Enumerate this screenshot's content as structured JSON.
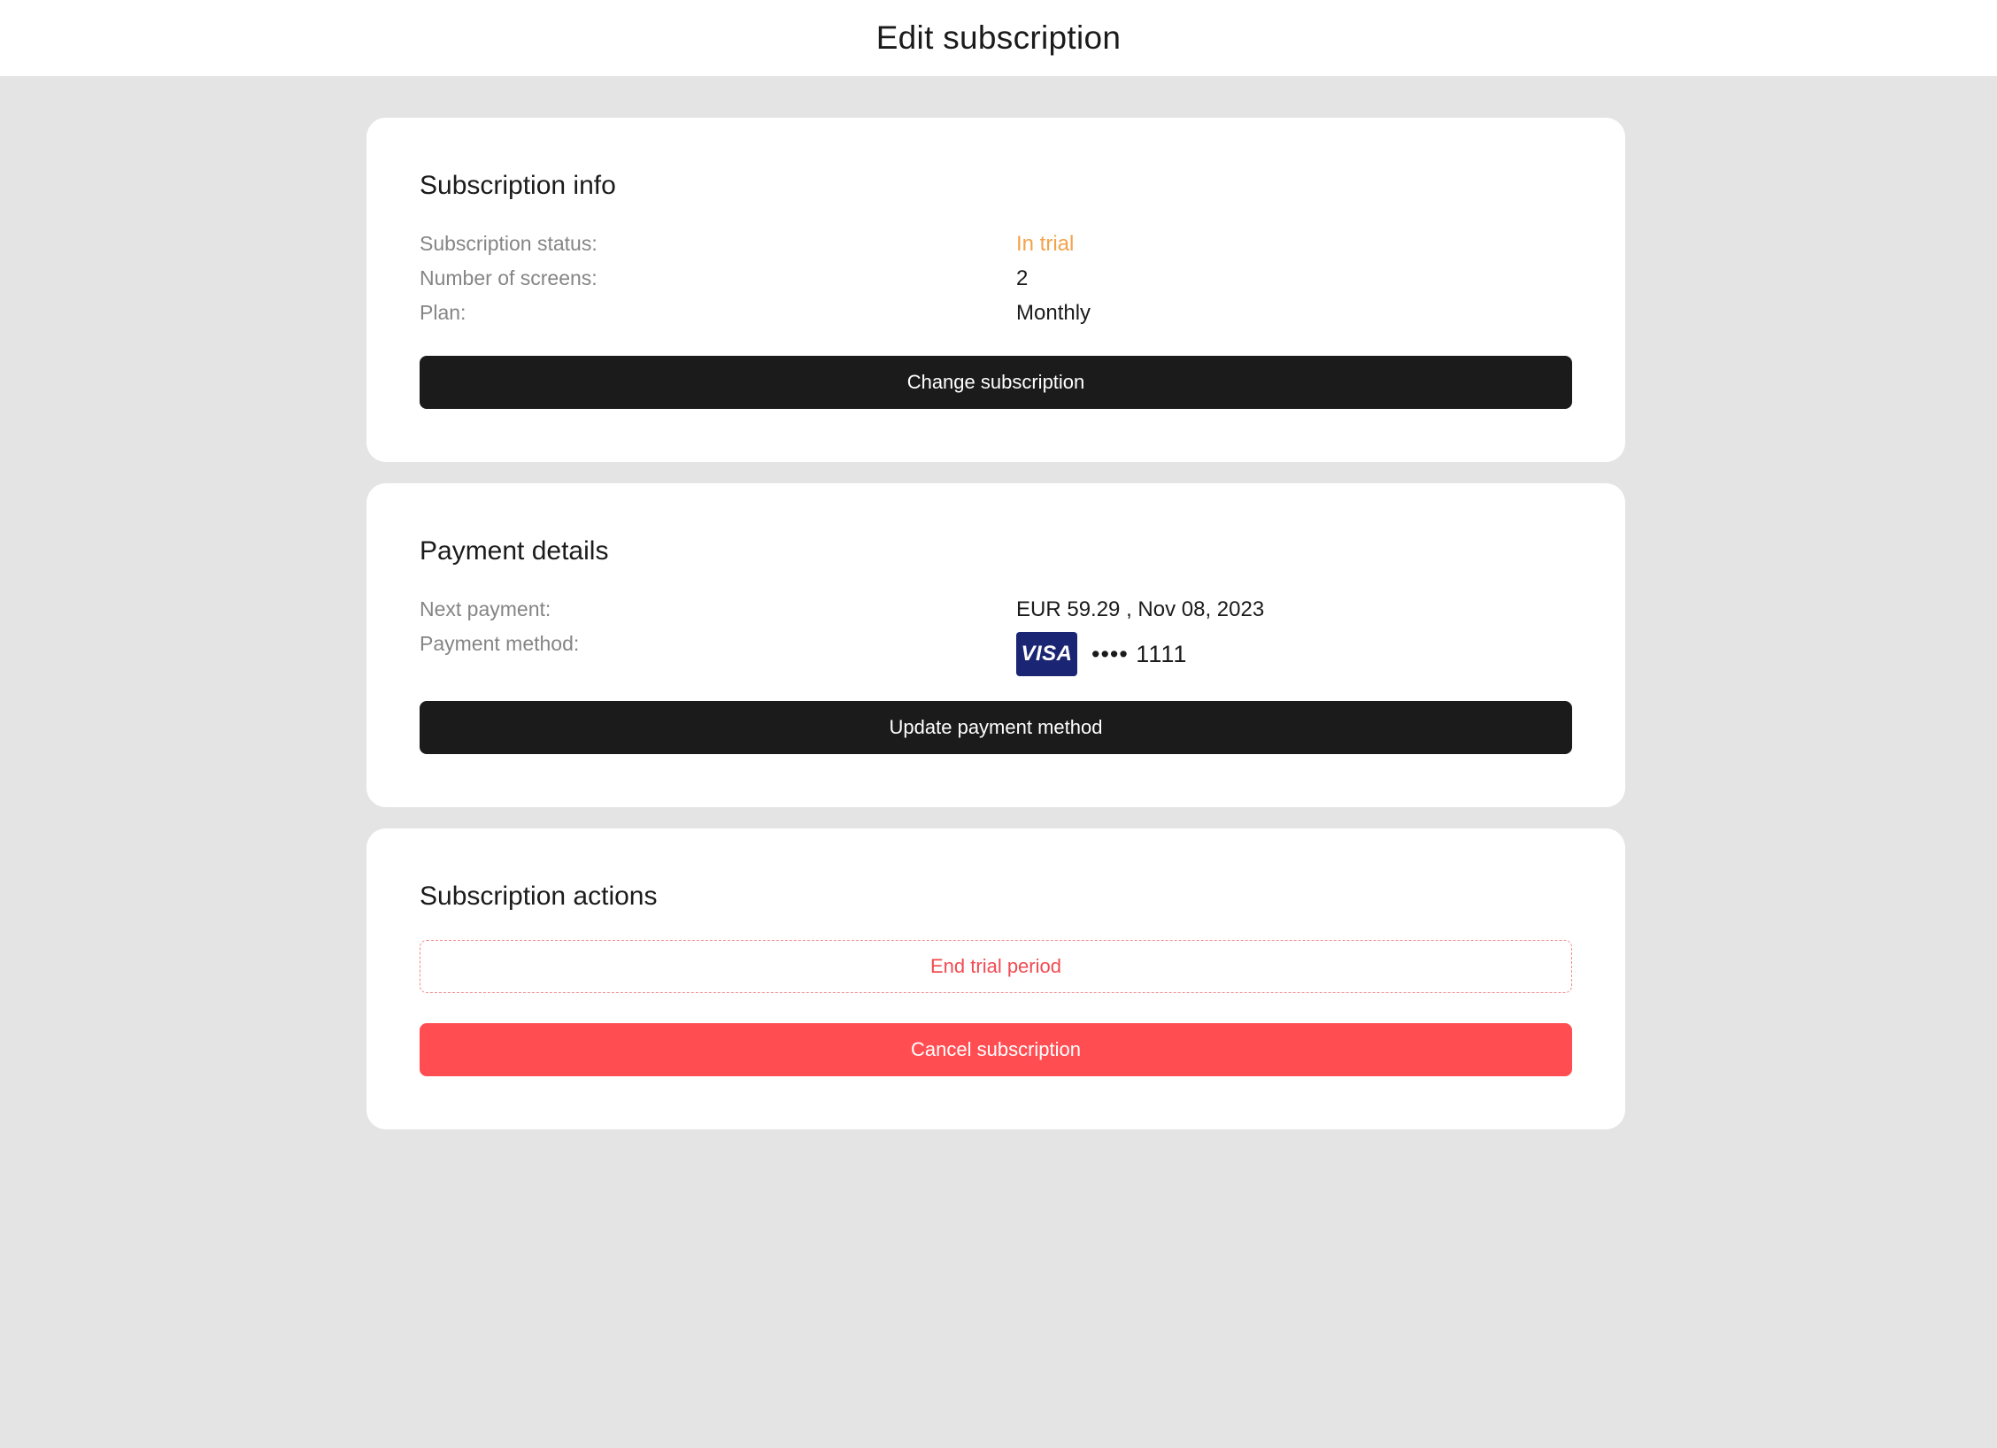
{
  "header": {
    "title": "Edit subscription"
  },
  "subscription_info": {
    "title": "Subscription info",
    "rows": [
      {
        "label": "Subscription status:",
        "value": "In trial"
      },
      {
        "label": "Number of screens:",
        "value": "2"
      },
      {
        "label": "Plan:",
        "value": "Monthly"
      }
    ],
    "button_label": "Change subscription",
    "status_color": "#f3a24a"
  },
  "payment_details": {
    "title": "Payment details",
    "next_payment_label": "Next payment:",
    "next_payment_value": "EUR 59.29 , Nov 08, 2023",
    "method_label": "Payment method:",
    "card_brand": "VISA",
    "card_masked": "•••• 1111",
    "card_icon": "visa-card-icon",
    "button_label": "Update payment method"
  },
  "subscription_actions": {
    "title": "Subscription actions",
    "end_trial_label": "End trial period",
    "cancel_label": "Cancel subscription",
    "danger_color": "#ff4d52"
  }
}
